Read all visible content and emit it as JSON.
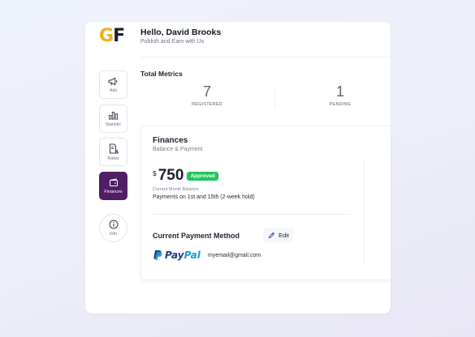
{
  "brand": {
    "logo_g": "G",
    "logo_f": "F",
    "logo_g_color": "#f2b019",
    "logo_f_color": "#1c1d2b"
  },
  "header": {
    "greeting": "Hello, David Brooks",
    "subtitle": "Publish and Earn with Us"
  },
  "sidebar": {
    "items": [
      {
        "label": "Ads",
        "icon": "megaphone-icon",
        "active": false
      },
      {
        "label": "Statistic",
        "icon": "bar-chart-icon",
        "active": false
      },
      {
        "label": "Rates",
        "icon": "document-dollar-icon",
        "active": false
      },
      {
        "label": "Finances",
        "icon": "wallet-icon",
        "active": true
      },
      {
        "label": "Info",
        "icon": "info-circle-icon",
        "active": false
      }
    ],
    "active_color": "#4f1e64"
  },
  "metrics": {
    "title": "Total Metrics",
    "items": [
      {
        "value": "7",
        "label": "REGISTERED"
      },
      {
        "value": "1",
        "label": "PENDING"
      }
    ]
  },
  "finances": {
    "title": "Finances",
    "subtitle": "Balance & Payment",
    "currency": "$",
    "amount": "750",
    "status": "Approved",
    "status_color": "#22c55e",
    "balance_caption": "Current Month Balance",
    "schedule": "Payments on 1st and 15th (2-week hold)",
    "payment_method_title": "Current Payment Method",
    "edit_label": "Edit",
    "provider_pay": "Pay",
    "provider_pal": "Pal",
    "email": "myemail@gmail.com"
  }
}
